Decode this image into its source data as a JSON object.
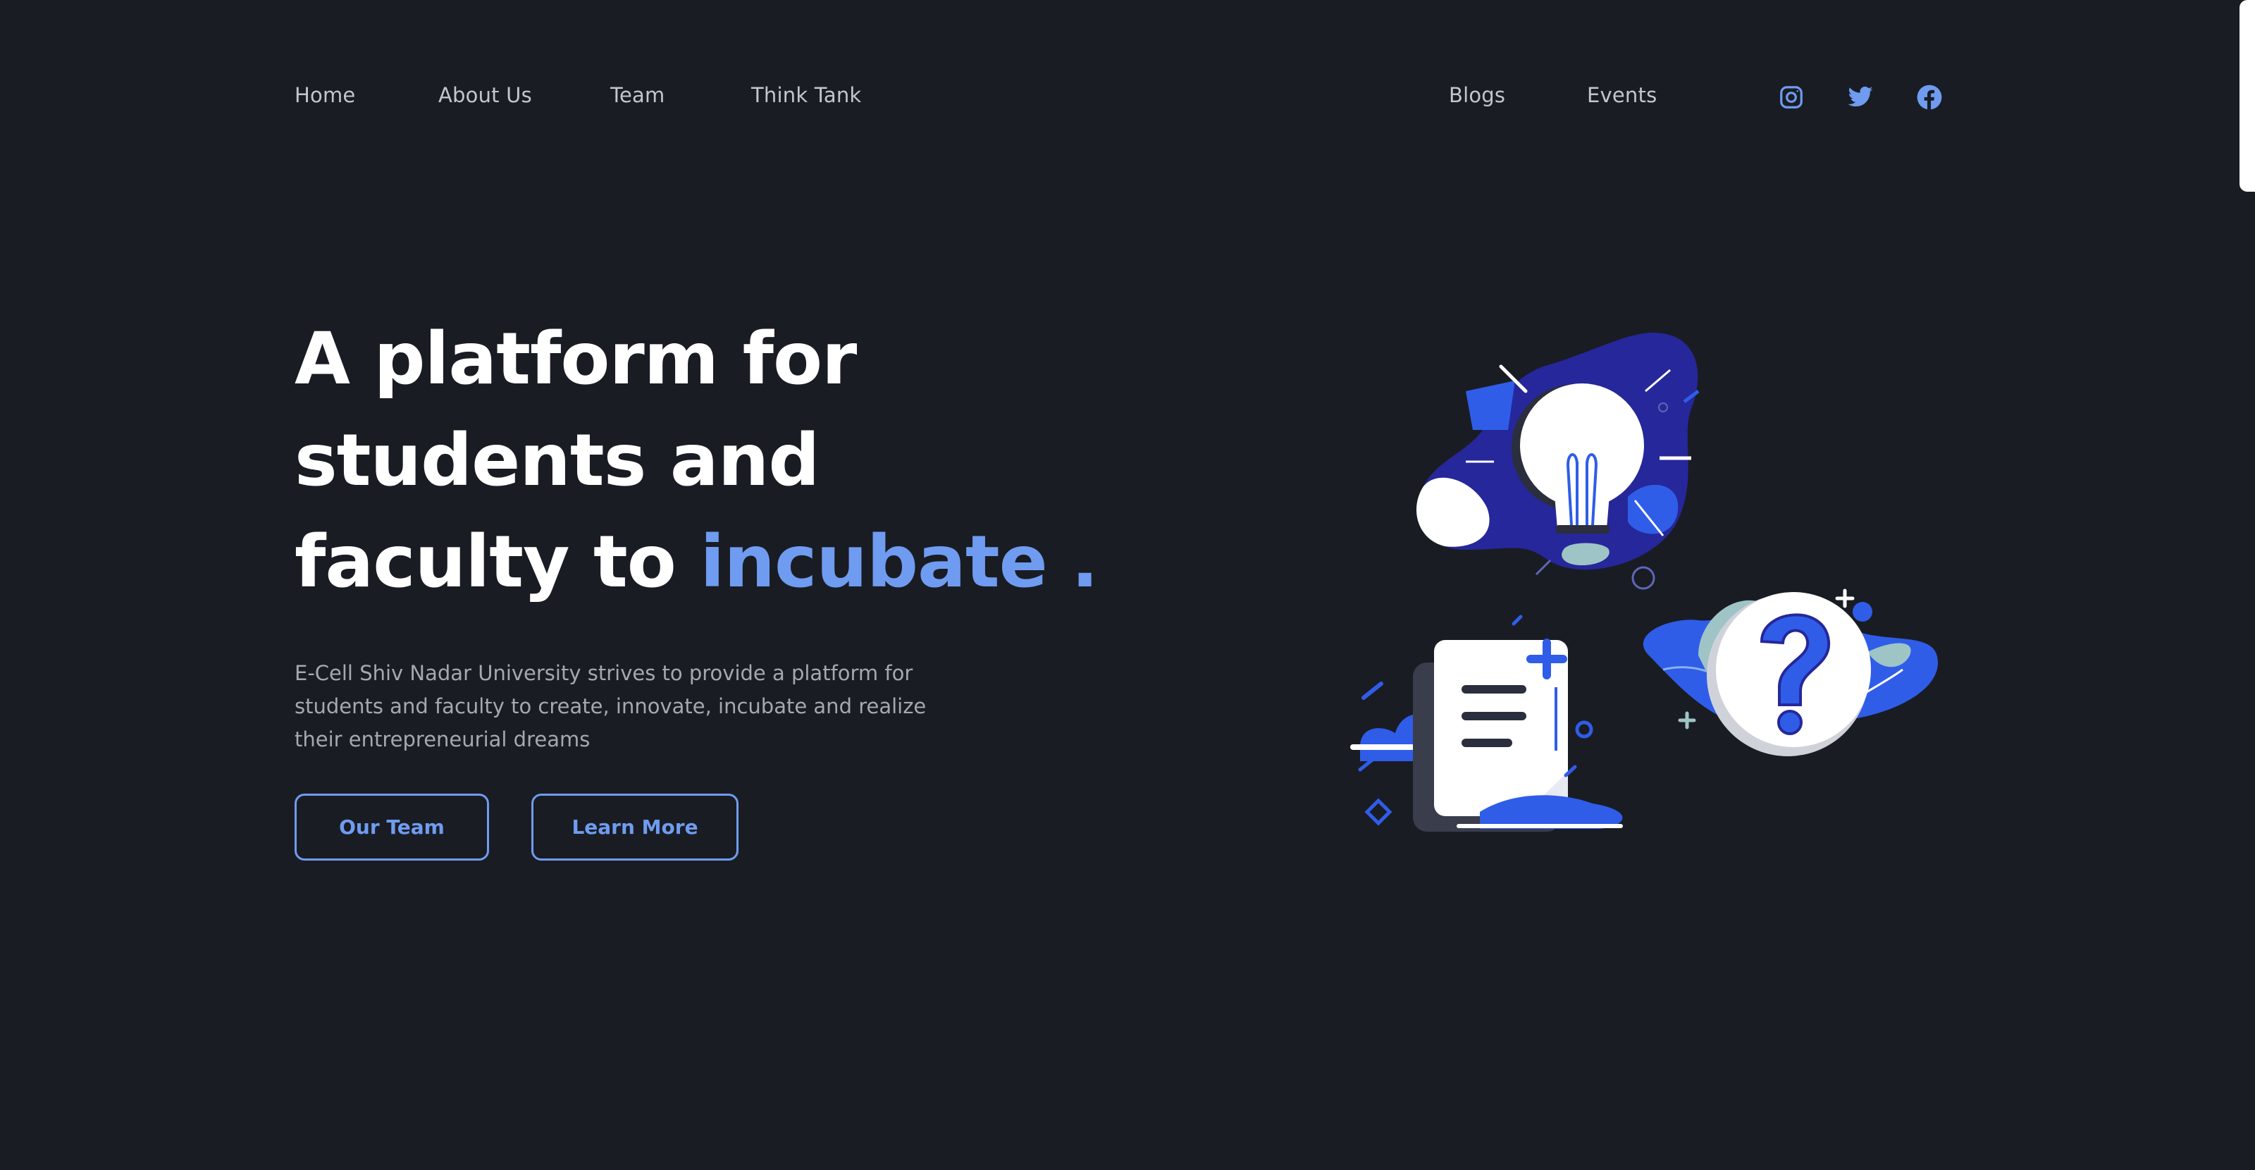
{
  "nav": {
    "links": [
      "Home",
      "About Us",
      "Team",
      "Think Tank",
      "Blogs",
      "Events"
    ],
    "social_icons": [
      "instagram-icon",
      "twitter-icon",
      "facebook-icon"
    ]
  },
  "hero": {
    "line1": "A platform for",
    "line2": "students and",
    "line3_prefix": "faculty to",
    "line3_accent": "incubate .",
    "description": "E-Cell Shiv Nadar University strives to provide a platform for students and faculty to create, innovate, incubate and realize their entrepreneurial dreams",
    "buttons": [
      "Our Team",
      "Learn More"
    ]
  },
  "illustration": {
    "icons": [
      "lightbulb-icon",
      "document-icon",
      "question-mark-icon"
    ]
  },
  "colors": {
    "background": "#1a1c24",
    "accent": "#6f9cf0",
    "nav_text": "#c4c6cd",
    "body_text": "#a6a8b0",
    "heading": "#ffffff"
  }
}
